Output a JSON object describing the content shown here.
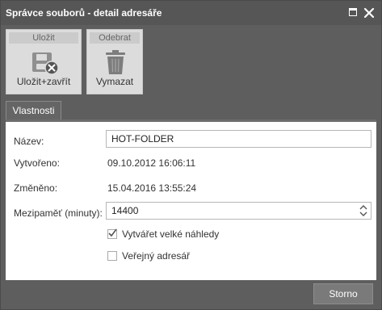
{
  "window": {
    "title": "Správce souborů - detail adresáře"
  },
  "toolbar": {
    "save_group_header": "Uložit",
    "save_close_label": "Uložit+zavřít",
    "remove_group_header": "Odebrat",
    "delete_label": "Vymazat"
  },
  "tabs": [
    {
      "label": "Vlastnosti",
      "active": true
    }
  ],
  "form": {
    "name_label": "Název:",
    "name_value": "HOT-FOLDER",
    "created_label": "Vytvořeno:",
    "created_value": "09.10.2012 16:06:11",
    "changed_label": "Změněno:",
    "changed_value": "15.04.2016 13:55:24",
    "cache_label": "Mezipaměť (minuty):",
    "cache_value": "14400",
    "thumbs_label": "Vytvářet velké náhledy",
    "thumbs_checked": true,
    "public_label": "Veřejný adresář",
    "public_checked": false
  },
  "footer": {
    "cancel_label": "Storno"
  },
  "colors": {
    "chrome": "#5e5e5e",
    "toolbar_group": "#dcdcdc",
    "content_bg": "#ffffff"
  },
  "icons": [
    "maximize-icon",
    "close-icon",
    "save-close-icon",
    "trash-icon",
    "spinner-arrows-icon",
    "checkmark-icon"
  ]
}
